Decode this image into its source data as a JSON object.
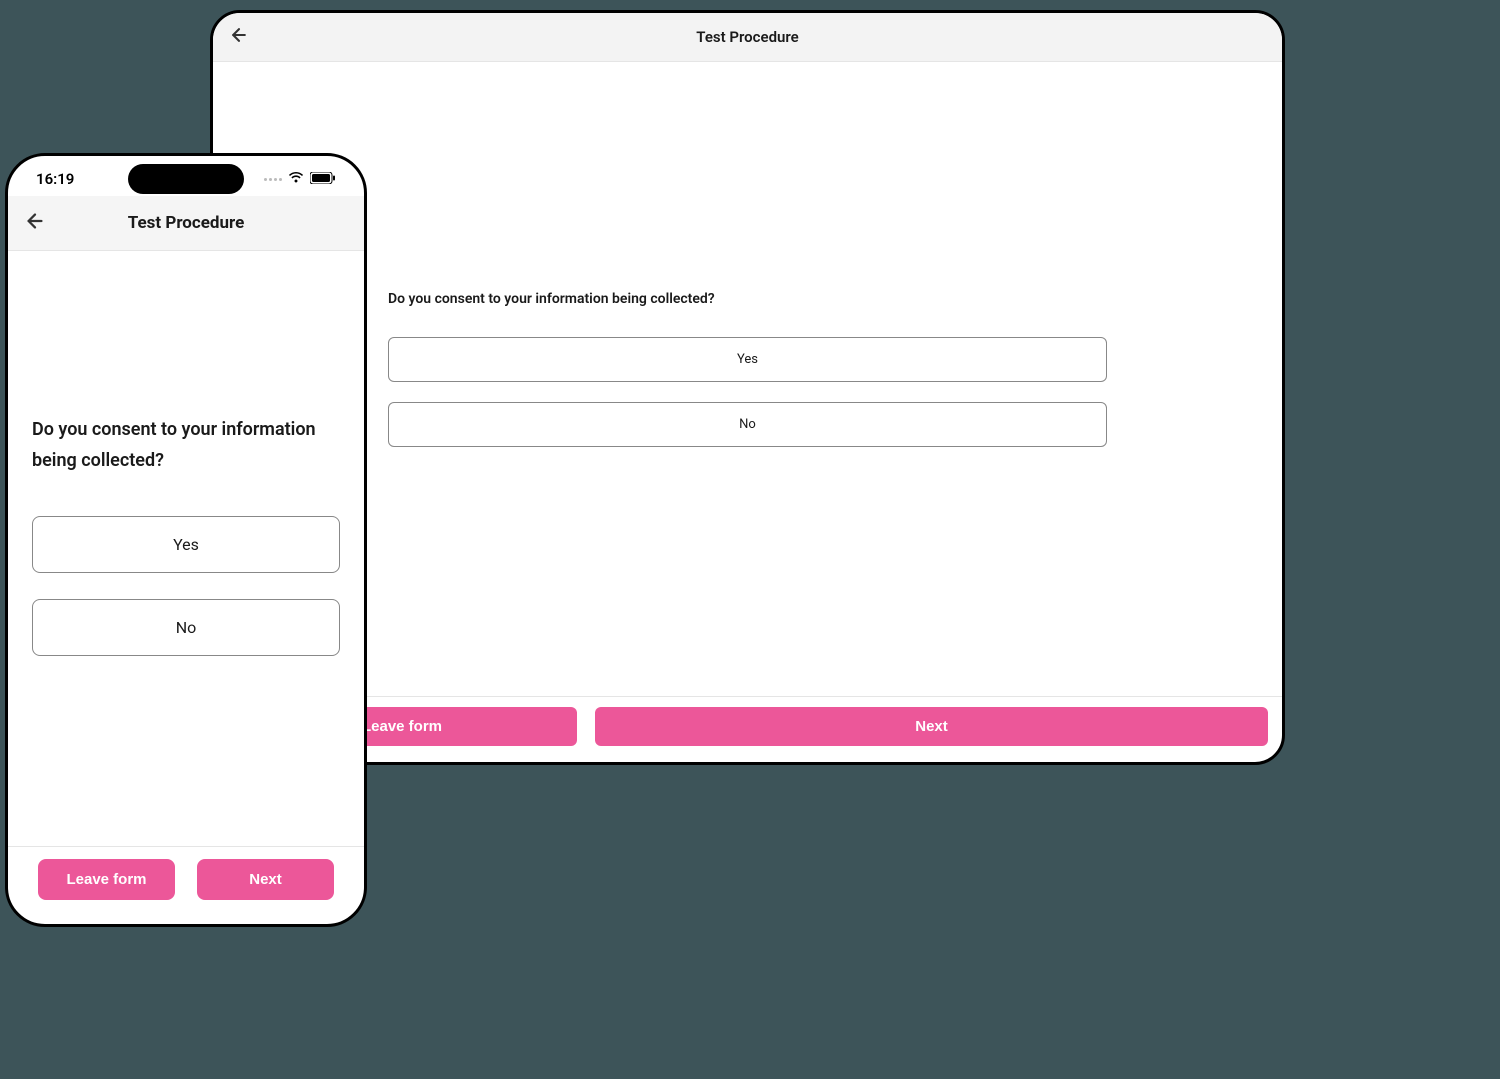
{
  "statusbar": {
    "time": "16:19"
  },
  "header": {
    "title": "Test Procedure"
  },
  "form": {
    "question": "Do you consent to your information being collected?",
    "options": {
      "yes": "Yes",
      "no": "No"
    }
  },
  "footer": {
    "leave_label": "Leave form",
    "next_label": "Next"
  },
  "colors": {
    "accent": "#ec5799"
  }
}
